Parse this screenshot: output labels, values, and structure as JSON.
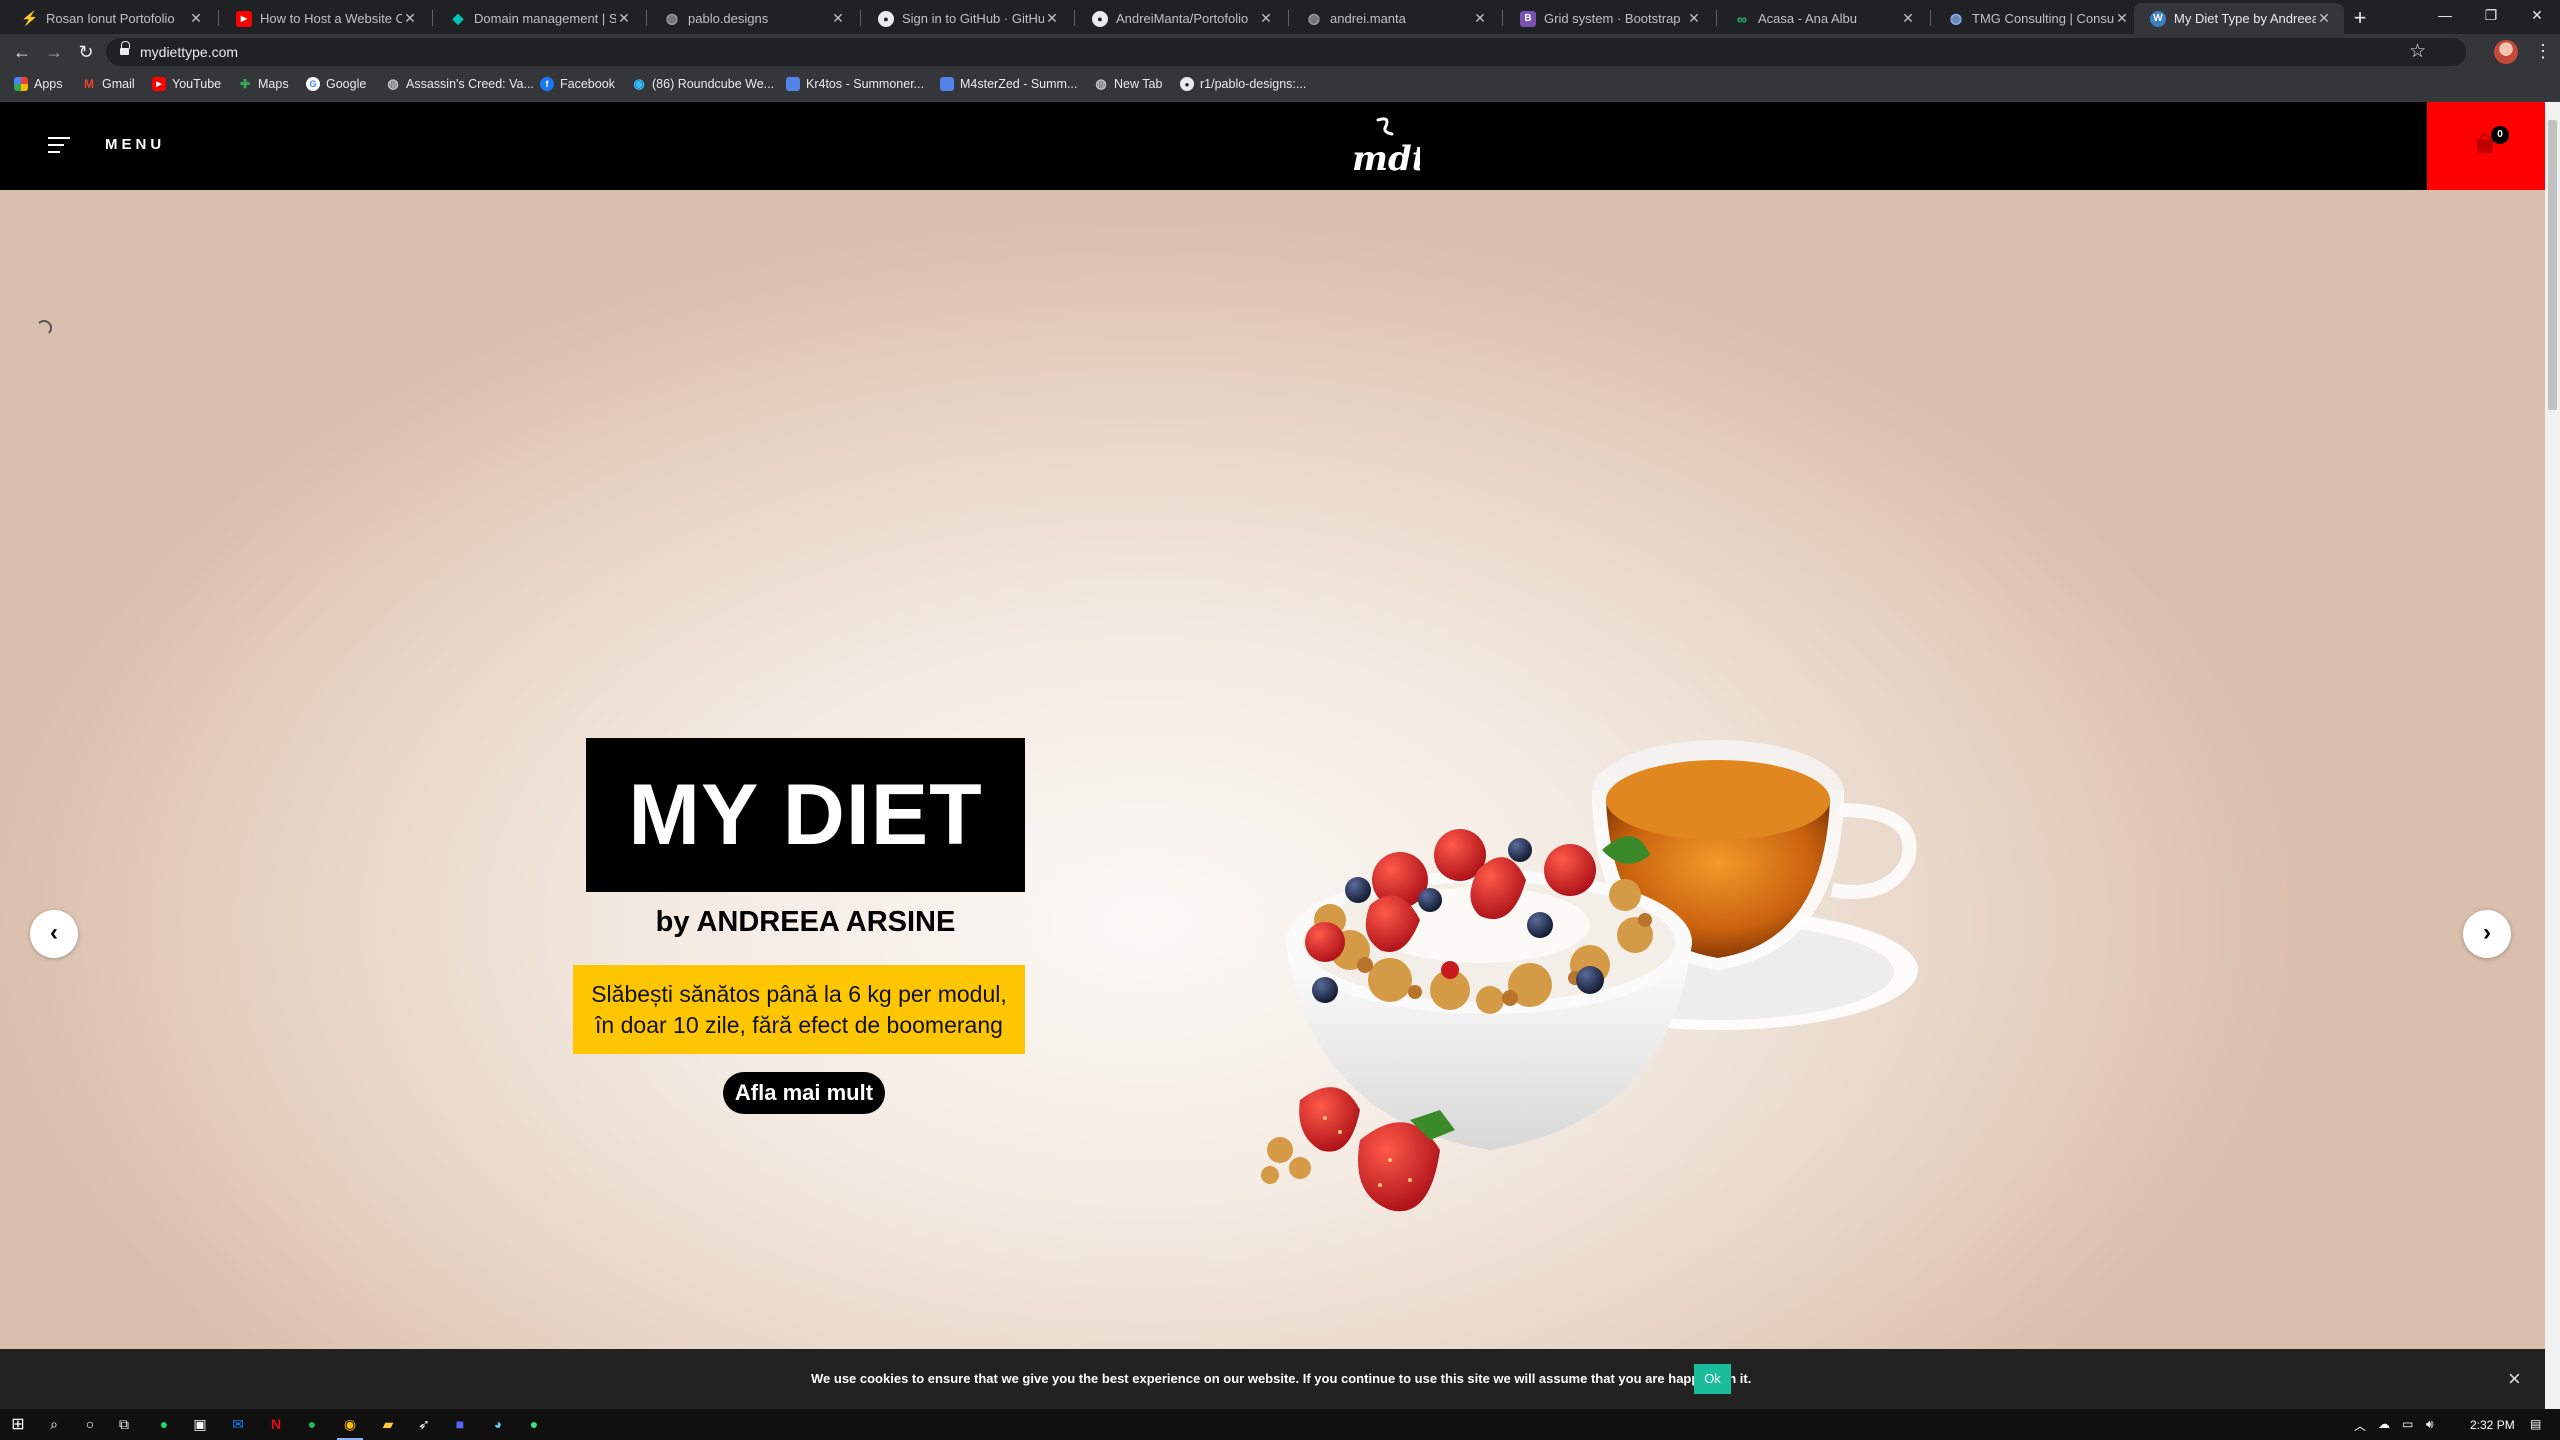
{
  "browser": {
    "tabs": [
      {
        "title": "Rosan Ionut Portofolio",
        "icon": "bolt-icon",
        "color": "#f5b400",
        "glyph": "⚡"
      },
      {
        "title": "How to Host a Website On G",
        "icon": "youtube-icon",
        "color": "#ff0000",
        "glyph": "▶"
      },
      {
        "title": "Domain management | Site",
        "icon": "diamond-icon",
        "color": "#00c7b7",
        "glyph": "◆"
      },
      {
        "title": "pablo.designs",
        "icon": "globe-icon",
        "color": "#5f6368",
        "glyph": "◍"
      },
      {
        "title": "Sign in to GitHub · GitHub",
        "icon": "github-icon",
        "color": "#e8eaed",
        "glyph": "●"
      },
      {
        "title": "AndreiManta/Portofolio",
        "icon": "github-icon",
        "color": "#e8eaed",
        "glyph": "●"
      },
      {
        "title": "andrei.manta",
        "icon": "globe-icon",
        "color": "#5f6368",
        "glyph": "◍"
      },
      {
        "title": "Grid system · Bootstrap",
        "icon": "bootstrap-icon",
        "color": "#7952b3",
        "glyph": "B"
      },
      {
        "title": "Acasa - Ana Albu",
        "icon": "link-icon",
        "color": "#2bb673",
        "glyph": "∞"
      },
      {
        "title": "TMG Consulting | Consulta",
        "icon": "globe-icon",
        "color": "#8ab4f8",
        "glyph": "◍"
      },
      {
        "title": "My Diet Type by Andreea A",
        "icon": "wordpress-icon",
        "color": "#3b7fc4",
        "glyph": "W"
      }
    ],
    "url": "mydiettype.com",
    "bookmarks": [
      {
        "label": "Apps",
        "icon": "apps-grid-icon",
        "color": "#ea4335",
        "glyph": "⋮"
      },
      {
        "label": "Gmail",
        "icon": "gmail-icon",
        "color": "#ea4335",
        "glyph": "M"
      },
      {
        "label": "YouTube",
        "icon": "youtube-icon",
        "color": "#ff0000",
        "glyph": "▶"
      },
      {
        "label": "Maps",
        "icon": "maps-icon",
        "color": "#34a853",
        "glyph": "✚"
      },
      {
        "label": "Google",
        "icon": "google-icon",
        "color": "#4285f4",
        "glyph": "G"
      },
      {
        "label": "Assassin's Creed: Va...",
        "icon": "globe-icon",
        "color": "#5f6368",
        "glyph": "◍"
      },
      {
        "label": "Facebook",
        "icon": "facebook-icon",
        "color": "#1877f2",
        "glyph": "f"
      },
      {
        "label": "(86) Roundcube We...",
        "icon": "roundcube-icon",
        "color": "#37beff",
        "glyph": "◉"
      },
      {
        "label": "Kr4tos - Summoner...",
        "icon": "opgg-icon",
        "color": "#5383e8",
        "glyph": "▬"
      },
      {
        "label": "M4sterZed - Summ...",
        "icon": "opgg-icon",
        "color": "#5383e8",
        "glyph": "▬"
      },
      {
        "label": "New Tab",
        "icon": "globe-icon",
        "color": "#5f6368",
        "glyph": "◍"
      },
      {
        "label": "r1/pablo-designs:...",
        "icon": "github-icon",
        "color": "#e8eaed",
        "glyph": "●"
      }
    ]
  },
  "site": {
    "menu_label": "MENU",
    "logo_text": "mdt",
    "cart_count": "0",
    "cart_color": "#ff0000",
    "slide": {
      "title": "MY DIET",
      "byline": "by ANDREEA ARSINE",
      "promo_line1": "Slăbești sănătos până la 6 kg per modul,",
      "promo_line2": "în doar 10 zile, fără efect de boomerang",
      "cta": "Afla mai mult",
      "promo_color": "#fec601"
    },
    "prev_arrow": "‹",
    "next_arrow": "›"
  },
  "cookie": {
    "text": "We use cookies to ensure that we give you the best experience on our website. If you continue to use this site we will assume that you are happy with it.",
    "ok": "Ok",
    "close": "×",
    "ok_color": "#1abc9c"
  },
  "taskbar": {
    "time": "2:32 PM"
  }
}
